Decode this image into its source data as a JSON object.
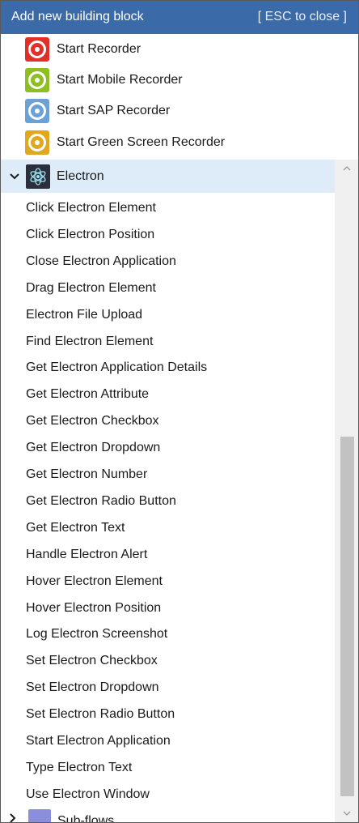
{
  "header": {
    "title": "Add new building block",
    "esc_label": "[ ESC to close ]"
  },
  "recorders": [
    {
      "label": "Start Recorder",
      "icon": "recorder-icon",
      "color": "#e0302a"
    },
    {
      "label": "Start Mobile Recorder",
      "icon": "mobile-recorder-icon",
      "color": "#8cbf1f"
    },
    {
      "label": "Start SAP Recorder",
      "icon": "sap-recorder-icon",
      "color": "#6aa1d6"
    },
    {
      "label": "Start Green Screen Recorder",
      "icon": "green-screen-recorder-icon",
      "color": "#e0a81f"
    }
  ],
  "group": {
    "label": "Electron",
    "expanded": true,
    "icon": "electron-logo-icon"
  },
  "actions": [
    "Click Electron Element",
    "Click Electron Position",
    "Close Electron Application",
    "Drag Electron Element",
    "Electron File Upload",
    "Find Electron Element",
    "Get Electron Application Details",
    "Get Electron Attribute",
    "Get Electron Checkbox",
    "Get Electron Dropdown",
    "Get Electron Number",
    "Get Electron Radio Button",
    "Get Electron Text",
    "Handle Electron Alert",
    "Hover Electron Element",
    "Hover Electron Position",
    "Log Electron Screenshot",
    "Set Electron Checkbox",
    "Set Electron Dropdown",
    "Set Electron Radio Button",
    "Start Electron Application",
    "Type Electron Text",
    "Use Electron Window"
  ],
  "subflows": {
    "label": "Sub-flows",
    "icon": "sub-flows-icon"
  },
  "colors": {
    "header_bg": "#3a6aa7",
    "group_highlight": "#deecf9"
  }
}
